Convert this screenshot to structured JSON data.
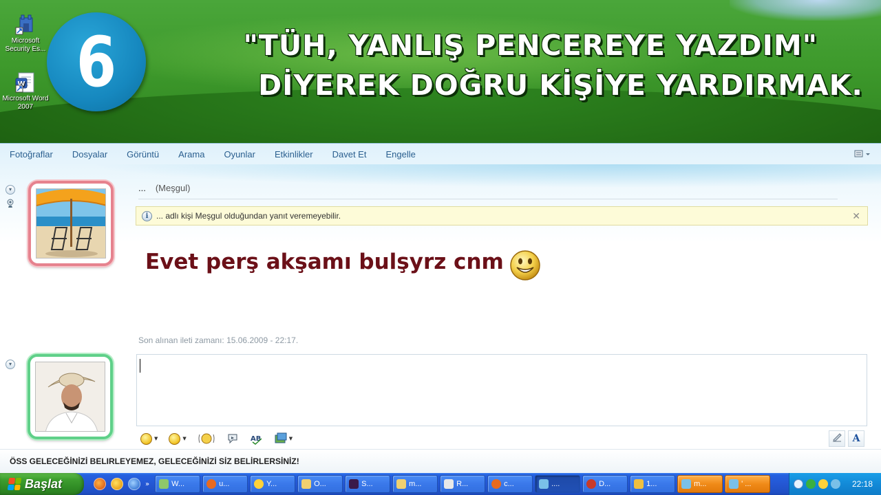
{
  "desktop": {
    "icons": [
      {
        "label": "Microsoft Security Es...",
        "icon": "security-essentials-icon"
      },
      {
        "label": "Microsoft Word 2007",
        "icon": "word-icon"
      }
    ],
    "step_number": "6",
    "headline_line1": "\"TÜH, YANLIŞ PENCEREYE YAZDIM\"",
    "headline_line2": "DİYEREK DOĞRU KİŞİYE YARDIRMAK."
  },
  "menu": {
    "items": [
      "Fotoğraflar",
      "Dosyalar",
      "Görüntü",
      "Arama",
      "Oyunlar",
      "Etkinlikler",
      "Davet Et",
      "Engelle"
    ]
  },
  "contact": {
    "name": "...",
    "status": "(Meşgul)"
  },
  "info_bar": {
    "text": "... adlı kişi Meşgul olduğundan yanıt veremeyebilir."
  },
  "message": {
    "text": "Evet perş akşamı bulşyrz cnm"
  },
  "last_message_time": "Son alınan ileti zamanı: 15.06.2009 - 22:17.",
  "input": {
    "value": ""
  },
  "ad_text": "ÖSS GELECEĞİNİZİ BELIRLEYEMEZ, GELECEĞİNİZİ SİZ BELİRLERSİNİZ!",
  "taskbar": {
    "start_label": "Başlat",
    "tasks": [
      "W...",
      "u...",
      "Y...",
      "O...",
      "S...",
      "m...",
      "R...",
      "c...",
      "....",
      "D...",
      "1...",
      "m...",
      "' ..."
    ],
    "clock": "22:18"
  },
  "colors": {
    "message_text": "#6b1018",
    "menu_text": "#2a5f8f",
    "step_circle": "#1688bf",
    "taskbar": "#2457d4",
    "start_button": "#3d9e2f"
  }
}
